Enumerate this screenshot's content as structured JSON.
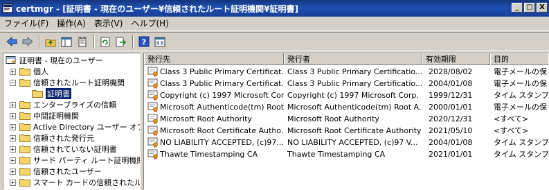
{
  "window": {
    "title": "certmgr - [証明書 - 現在のユーザー¥信頼されたルート証明機関¥証明書]",
    "min": "_",
    "max": "□",
    "close": "X"
  },
  "menu": [
    {
      "label": "ファイル(F)"
    },
    {
      "label": "操作(A)"
    },
    {
      "label": "表示(V)"
    },
    {
      "label": "ヘルプ(H)"
    }
  ],
  "tree": {
    "root": "証明書 - 現在のユーザー",
    "items": [
      {
        "label": "個人"
      },
      {
        "label": "信頼されたルート証明機関"
      },
      {
        "label": "証明書"
      },
      {
        "label": "エンタープライズの信頼"
      },
      {
        "label": "中間証明機関"
      },
      {
        "label": "Active Directory ユーザー オブジ"
      },
      {
        "label": "信頼された発行元"
      },
      {
        "label": "信頼されていない証明書"
      },
      {
        "label": "サード パーティ ルート証明機関"
      },
      {
        "label": "信頼されたユーザー"
      },
      {
        "label": "スマート カードの信頼されたルート"
      }
    ]
  },
  "list": {
    "columns": [
      "発行先",
      "発行者",
      "有効期限",
      "目的"
    ],
    "rows": [
      {
        "to": "Class 3 Public Primary Certificat...",
        "by": "Class 3 Public Primary Certificatio...",
        "exp": "2028/08/02",
        "purpose": "電子メールの保"
      },
      {
        "to": "Class 3 Public Primary Certificat...",
        "by": "Class 3 Public Primary Certificatio...",
        "exp": "2004/01/08",
        "purpose": "電子メールの保"
      },
      {
        "to": "Copyright (c) 1997 Microsoft Cor...",
        "by": "Copyright (c) 1997 Microsoft Corp.",
        "exp": "1999/12/31",
        "purpose": "タイム スタンプ"
      },
      {
        "to": "Microsoft Authenticode(tm) Root...",
        "by": "Microsoft Authenticode(tm) Root A...",
        "exp": "2000/01/01",
        "purpose": "電子メールの保"
      },
      {
        "to": "Microsoft Root Authority",
        "by": "Microsoft Root Authority",
        "exp": "2020/12/31",
        "purpose": "<すべて>"
      },
      {
        "to": "Microsoft Root Certificate Autho...",
        "by": "Microsoft Root Certificate Authority",
        "exp": "2021/05/10",
        "purpose": "<すべて>"
      },
      {
        "to": "NO LIABILITY ACCEPTED, (c)97...",
        "by": "NO LIABILITY ACCEPTED, (c)97 V...",
        "exp": "2004/01/08",
        "purpose": "タイム スタンプ"
      },
      {
        "to": "Thawte Timestamping CA",
        "by": "Thawte Timestamping CA",
        "exp": "2021/01/01",
        "purpose": "タイム スタンプ"
      }
    ]
  },
  "icons": [
    "back-icon",
    "forward-icon",
    "up-folder-icon",
    "show-tree-icon",
    "properties-icon",
    "refresh-icon",
    "export-icon",
    "help-icon",
    "console-icon"
  ]
}
